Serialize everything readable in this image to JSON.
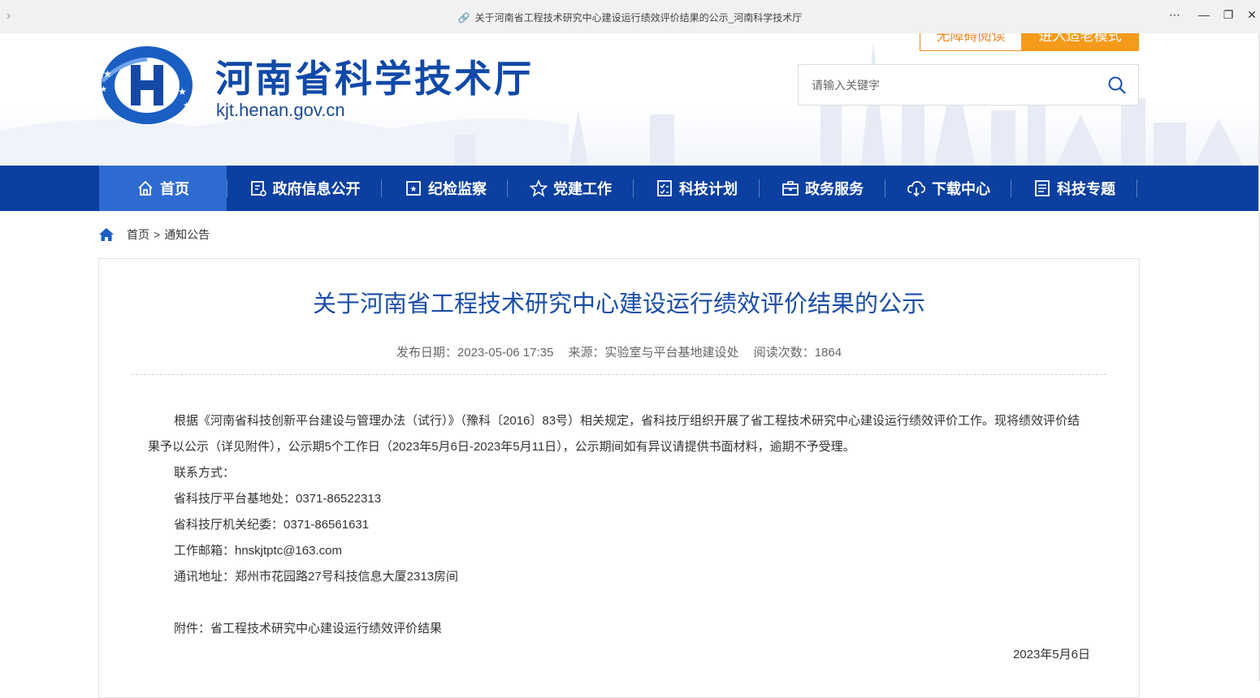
{
  "browser": {
    "tab_title": "关于河南省工程技术研究中心建设运行绩效评价结果的公示_河南科学技术厅"
  },
  "header": {
    "site_name": "河南省科学技术厅",
    "site_url": "kjt.henan.gov.cn",
    "accessible_label": "无障碍阅读",
    "elder_label": "进入适老模式",
    "search_placeholder": "请输入关键字"
  },
  "nav": {
    "items": [
      {
        "label": "首页",
        "icon": "home-icon"
      },
      {
        "label": "政府信息公开",
        "icon": "info-disclosure-icon"
      },
      {
        "label": "纪检监察",
        "icon": "inspection-icon"
      },
      {
        "label": "党建工作",
        "icon": "star-icon"
      },
      {
        "label": "科技计划",
        "icon": "checklist-icon"
      },
      {
        "label": "政务服务",
        "icon": "briefcase-icon"
      },
      {
        "label": "下载中心",
        "icon": "cloud-download-icon"
      },
      {
        "label": "科技专题",
        "icon": "document-icon"
      }
    ]
  },
  "breadcrumb": {
    "home": "首页",
    "separator": ">",
    "current": "通知公告"
  },
  "article": {
    "title": "关于河南省工程技术研究中心建设运行绩效评价结果的公示",
    "date": "发布日期：2023-05-06 17:35",
    "source": "来源：实验室与平台基地建设处",
    "views": "阅读次数：1864",
    "paragraph": "根据《河南省科技创新平台建设与管理办法（试行）》（豫科〔2016〕83号）相关规定，省科技厅组织开展了省工程技术研究中心建设运行绩效评价工作。现将绩效评价结果予以公示（详见附件），公示期5个工作日（2023年5月6日-2023年5月11日），公示期间如有异议请提供书面材料，逾期不予受理。",
    "contact_heading": "联系方式：",
    "contact_platform": "省科技厅平台基地处：0371-86522313",
    "contact_discipline": "省科技厅机关纪委：0371-86561631",
    "email": "工作邮箱：hnskjtptc@163.com",
    "address": "通讯地址：郑州市花园路27号科技信息大厦2313房间",
    "attachment": "附件：省工程技术研究中心建设运行绩效评价结果",
    "sign_date": "2023年5月6日"
  }
}
